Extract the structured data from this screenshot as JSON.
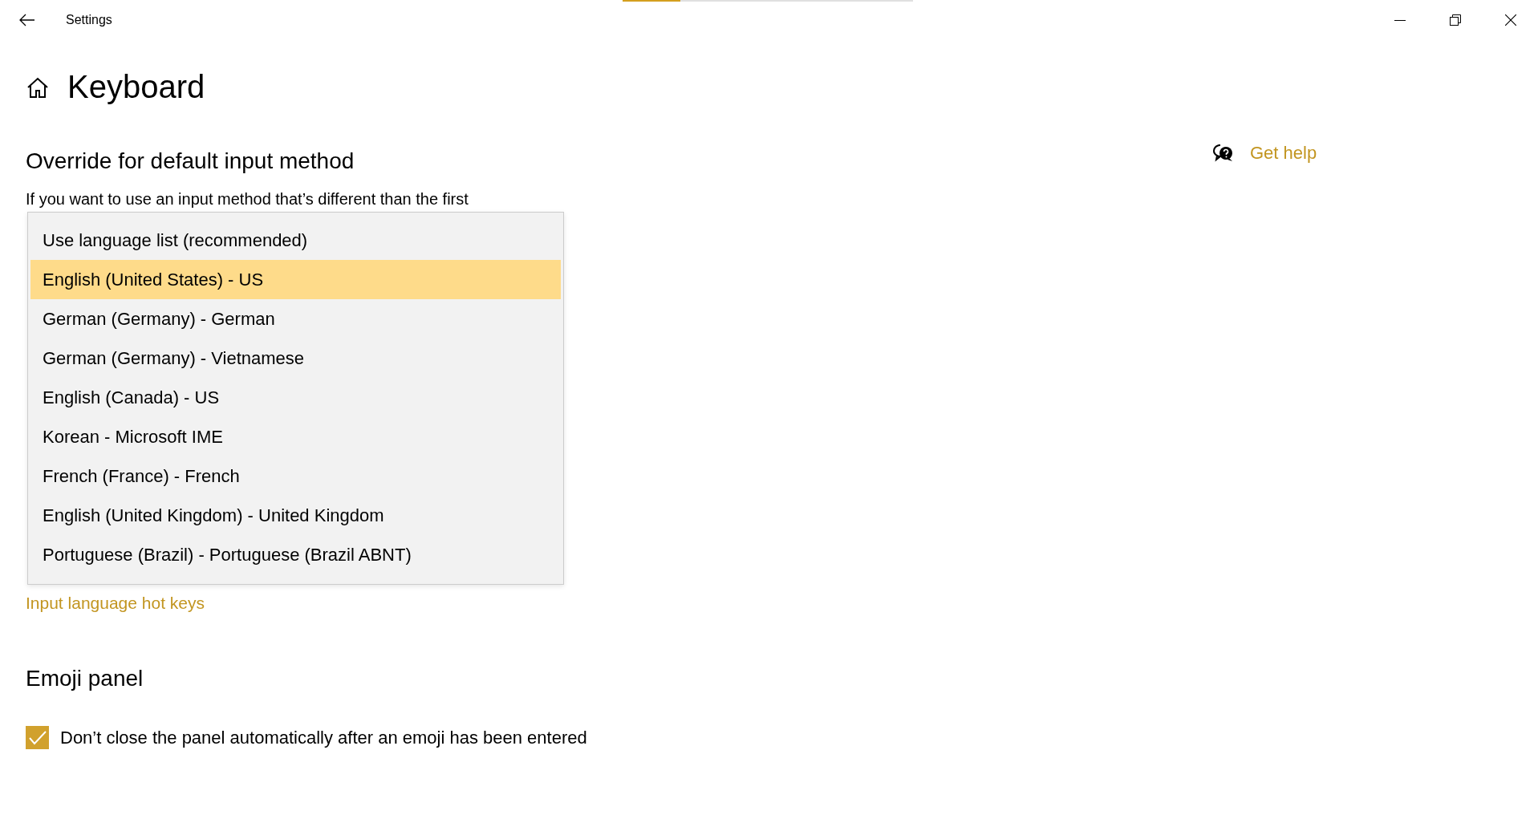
{
  "window": {
    "title": "Settings",
    "loading_bar": {
      "level": 0.2
    }
  },
  "page": {
    "title": "Keyboard"
  },
  "get_help": "Get help",
  "override": {
    "heading": "Override for default input method",
    "description": "If you want to use an input method that’s different than the first",
    "dropdown": {
      "options": [
        {
          "label": "Use language list (recommended)",
          "selected": false
        },
        {
          "label": "English (United States) - US",
          "selected": true
        },
        {
          "label": "German (Germany) - German",
          "selected": false
        },
        {
          "label": "German (Germany) - Vietnamese",
          "selected": false
        },
        {
          "label": "English (Canada) - US",
          "selected": false
        },
        {
          "label": "Korean - Microsoft IME",
          "selected": false
        },
        {
          "label": "French (France) - French",
          "selected": false
        },
        {
          "label": "English (United Kingdom) - United Kingdom",
          "selected": false
        },
        {
          "label": "Portuguese (Brazil) - Portuguese (Brazil ABNT)",
          "selected": false
        }
      ]
    },
    "link": "Input language hot keys"
  },
  "emoji": {
    "heading": "Emoji panel",
    "checkbox": {
      "label": "Don’t close the panel automatically after an emoji has been entered",
      "checked": true
    }
  }
}
